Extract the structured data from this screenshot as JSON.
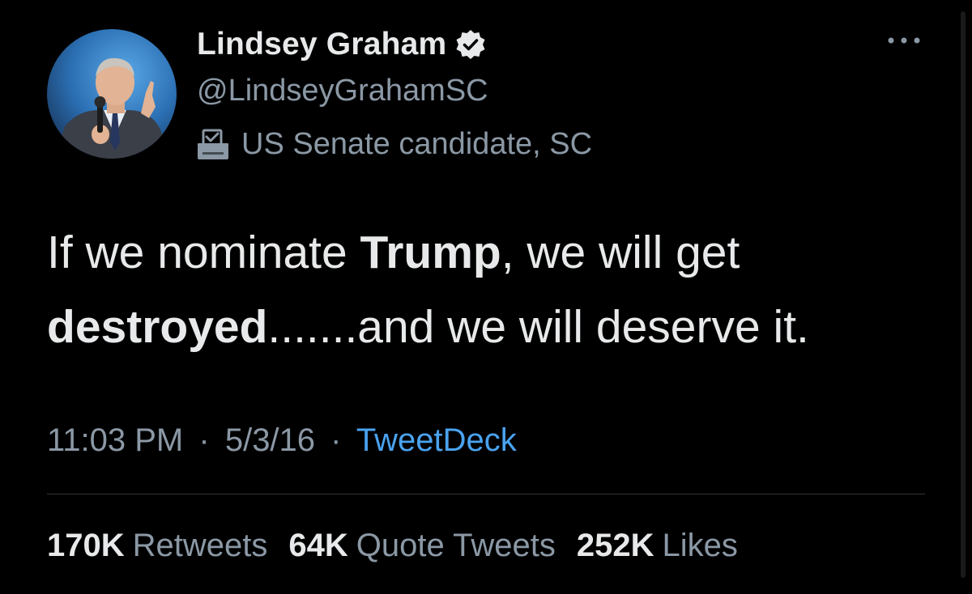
{
  "author": {
    "display_name": "Lindsey Graham",
    "handle": "@LindseyGrahamSC",
    "verified": true,
    "label": "US Senate candidate, SC",
    "label_icon": "ballot-box-icon"
  },
  "tweet": {
    "segments": [
      {
        "text": "If we nominate ",
        "bold": false
      },
      {
        "text": "Trump",
        "bold": true
      },
      {
        "text": ", we will get ",
        "bold": false
      },
      {
        "text": "destroyed",
        "bold": true
      },
      {
        "text": ".......and we will deserve it.",
        "bold": false
      }
    ]
  },
  "meta": {
    "time": "11:03 PM",
    "separator": "·",
    "date": "5/3/16",
    "source": "TweetDeck"
  },
  "stats": {
    "retweets_count": "170K",
    "retweets_label": "Retweets",
    "quotes_count": "64K",
    "quotes_label": "Quote Tweets",
    "likes_count": "252K",
    "likes_label": "Likes"
  },
  "colors": {
    "background": "#000000",
    "primary_text": "#e7e9ea",
    "secondary_text": "#8b98a5",
    "link": "#4aa3f0",
    "divider": "#2f3336"
  },
  "icons": {
    "verified": "verified-badge-icon",
    "more": "more-options-icon"
  }
}
